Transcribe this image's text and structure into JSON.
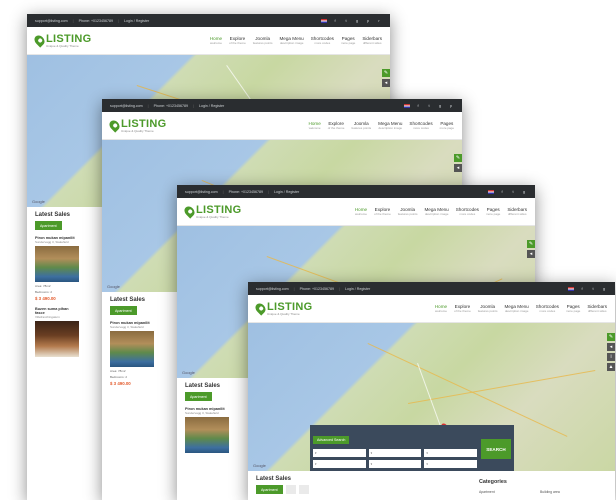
{
  "brand": {
    "name": "LISTING",
    "tagline": "Unique & Quality Theme"
  },
  "topbar": {
    "email": "support@listing.com",
    "phone": "Phone: +0123456789",
    "login": "Login / Register"
  },
  "nav": [
    {
      "label": "Home",
      "sub": "welcome"
    },
    {
      "label": "Explore",
      "sub": "of the theme"
    },
    {
      "label": "Joomla",
      "sub": "features points"
    },
    {
      "label": "Mega Menu",
      "sub": "description image"
    },
    {
      "label": "Shortcodes",
      "sub": "more codes"
    },
    {
      "label": "Pages",
      "sub": "more page"
    },
    {
      "label": "Siderbars",
      "sub": "different sides"
    }
  ],
  "social_icons": [
    "facebook-icon",
    "twitter-icon",
    "googleplus-icon",
    "pinterest-icon",
    "rss-icon"
  ],
  "latest_sales": "Latest Sales",
  "tab_apartment": "Apartment",
  "listing": {
    "title": "Piron mukan mipanilit",
    "address": "Sundervagg 3, Stakefield",
    "area": "Area: 78m2",
    "bedrooms": "Bedrooms: 2",
    "price": "$ 3 490.00"
  },
  "listing2": {
    "title": "Buzen suma pihan fasce",
    "address": "Villefranchingaturn"
  },
  "search": {
    "advanced": "Advanced Search",
    "button": "SEARCH"
  },
  "categories": {
    "title": "Categories",
    "items": [
      "Apartment",
      "Building area"
    ]
  },
  "map_label": "Google",
  "colors": {
    "brand": "#4c9a2a",
    "price": "#e35b2d",
    "topbar": "#2a2d30"
  }
}
